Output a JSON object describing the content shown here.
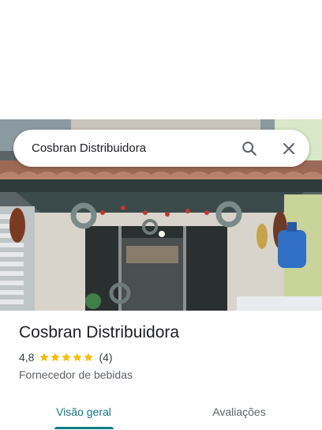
{
  "search": {
    "value": "Cosbran Distribuidora",
    "search_icon": "search-icon",
    "close_icon": "close-icon"
  },
  "place": {
    "name": "Cosbran Distribuidora",
    "rating": "4,8",
    "stars_filled": 5,
    "review_count": "(4)",
    "category": "Fornecedor de bebidas"
  },
  "tabs": [
    {
      "label": "Visão geral",
      "active": true
    },
    {
      "label": "Avaliações",
      "active": false
    }
  ],
  "colors": {
    "accent": "#0f7d89",
    "star": "#fbbc04"
  }
}
